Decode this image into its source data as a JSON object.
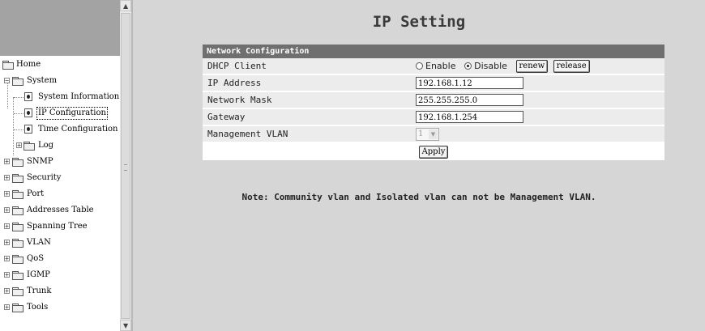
{
  "nav": {
    "items": [
      {
        "label": "Home"
      },
      {
        "label": "System"
      },
      {
        "label": "System Information"
      },
      {
        "label": "IP Configuration"
      },
      {
        "label": "Time Configuration"
      },
      {
        "label": "Log"
      },
      {
        "label": "SNMP"
      },
      {
        "label": "Security"
      },
      {
        "label": "Port"
      },
      {
        "label": "Addresses Table"
      },
      {
        "label": "Spanning Tree"
      },
      {
        "label": "VLAN"
      },
      {
        "label": "QoS"
      },
      {
        "label": "IGMP"
      },
      {
        "label": "Trunk"
      },
      {
        "label": "Tools"
      }
    ],
    "selected": "IP Configuration",
    "icons": {
      "folder": "folder-icon",
      "page": "page-icon",
      "expand": "plus",
      "collapse": "minus"
    }
  },
  "page": {
    "title": "IP Setting"
  },
  "config": {
    "section_title": "Network Configuration",
    "dhcp": {
      "label": "DHCP Client",
      "enable_label": "Enable",
      "disable_label": "Disable",
      "selected": "Disable",
      "renew_label": "renew",
      "release_label": "release"
    },
    "ip": {
      "label": "IP Address",
      "value": "192.168.1.12"
    },
    "mask": {
      "label": "Network Mask",
      "value": "255.255.255.0"
    },
    "gateway": {
      "label": "Gateway",
      "value": "192.168.1.254"
    },
    "vlan": {
      "label": "Management VLAN",
      "value": "1"
    },
    "apply_label": "Apply"
  },
  "note": "Note: Community vlan and Isolated vlan can not be Management VLAN.",
  "colors": {
    "header_bar": "#6f6f6f",
    "background": "#d6d6d6",
    "logo_band": "#a3a3a3"
  }
}
